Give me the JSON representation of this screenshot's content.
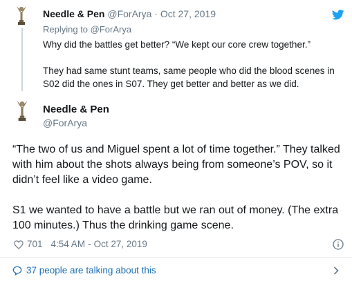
{
  "colors": {
    "text": "#14171a",
    "muted": "#657786",
    "link": "#1b6fb5",
    "twitter_blue": "#1da1f2",
    "divider": "#e1e8ed"
  },
  "parent_tweet": {
    "author_name": "Needle & Pen",
    "author_handle": "@ForArya",
    "separator": "·",
    "date": "Oct 27, 2019",
    "replying_prefix": "Replying to",
    "replying_handle": "@ForArya",
    "text_paragraphs": [
      "Why did the battles get better? “We kept our core crew together.”",
      "They had same stunt teams, same people who did the blood scenes in S02 did the ones in S07. They get better and better as we did."
    ],
    "avatar_icon": "emmy-statuette-icon",
    "platform_icon": "twitter-bird-icon"
  },
  "main_tweet": {
    "author_name": "Needle & Pen",
    "author_handle": "@ForArya",
    "avatar_icon": "emmy-statuette-icon",
    "text_paragraphs": [
      "“The two of us and Miguel spent a lot of time together.” They talked with him about the shots always being from someone’s POV, so it didn’t feel like a video game.",
      "S1 we wanted to have a battle but we ran out of money. (The extra 100 minutes.) Thus the drinking game scene."
    ],
    "likes": "701",
    "time": "4:54 AM",
    "separator": "-",
    "date": "Oct 27, 2019"
  },
  "footer": {
    "talking_text": "37 people are talking about this"
  }
}
